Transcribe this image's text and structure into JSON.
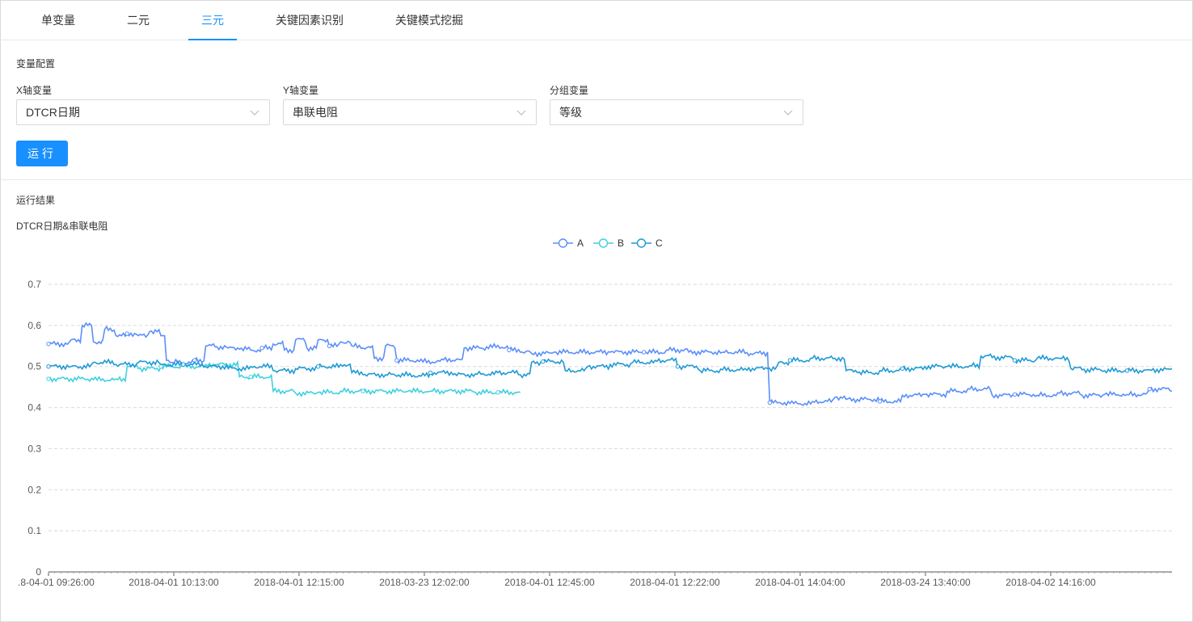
{
  "tabs": [
    {
      "label": "单变量",
      "active": false
    },
    {
      "label": "二元",
      "active": false
    },
    {
      "label": "三元",
      "active": true
    },
    {
      "label": "关键因素识别",
      "active": false
    },
    {
      "label": "关键模式挖掘",
      "active": false
    }
  ],
  "config": {
    "title": "变量配置",
    "x_label": "X轴变量",
    "x_value": "DTCR日期",
    "y_label": "Y轴变量",
    "y_value": "串联电阻",
    "group_label": "分组变量",
    "group_value": "等级",
    "run_label": "运行"
  },
  "result": {
    "title": "运行结果",
    "chart_title": "DTCR日期&串联电阻"
  },
  "colors": {
    "accent": "#1890ff",
    "series_a": "#5b8ff9",
    "series_b": "#3fd0e0",
    "series_c": "#1e9ad6"
  },
  "chart_data": {
    "type": "line",
    "title": "DTCR日期&串联电阻",
    "xlabel": "",
    "ylabel": "",
    "ylim": [
      0,
      0.7
    ],
    "y_ticks": [
      "0",
      "0.1",
      "0.2",
      "0.3",
      "0.4",
      "0.5",
      "0.6",
      "0.7"
    ],
    "x_tick_labels": [
      ".8-04-01 09:26:00",
      "2018-04-01 10:13:00",
      "2018-04-01 12:15:00",
      "2018-03-23 12:02:00",
      "2018-04-01 12:45:00",
      "2018-04-01 12:22:00",
      "2018-04-01 14:04:00",
      "2018-03-24 13:40:00",
      "2018-04-02 14:16:00"
    ],
    "legend": [
      "A",
      "B",
      "C"
    ],
    "legend_position": "top-center",
    "grid": true,
    "x_range": [
      0,
      100
    ],
    "series": [
      {
        "name": "A",
        "x": [
          0,
          2,
          3,
          4,
          5,
          6,
          7,
          8,
          9,
          10,
          10.5,
          11,
          13,
          14,
          15,
          16,
          17,
          18,
          19,
          20,
          21,
          22,
          23,
          24,
          25,
          26,
          27,
          28,
          29,
          30,
          31,
          33,
          35,
          36,
          37,
          39,
          41,
          42,
          43,
          45,
          47,
          50,
          53,
          55,
          57,
          60,
          62,
          64,
          64.2,
          66,
          68,
          70,
          71,
          72,
          74,
          76,
          78,
          80,
          82,
          84,
          86,
          88,
          90,
          92,
          94,
          96,
          98,
          100
        ],
        "values": [
          0.555,
          0.565,
          0.6,
          0.56,
          0.59,
          0.575,
          0.58,
          0.575,
          0.585,
          0.575,
          0.515,
          0.51,
          0.515,
          0.55,
          0.548,
          0.545,
          0.542,
          0.54,
          0.545,
          0.555,
          0.54,
          0.565,
          0.545,
          0.565,
          0.55,
          0.56,
          0.55,
          0.545,
          0.52,
          0.55,
          0.515,
          0.512,
          0.518,
          0.515,
          0.545,
          0.548,
          0.54,
          0.535,
          0.532,
          0.535,
          0.535,
          0.535,
          0.535,
          0.54,
          0.535,
          0.535,
          0.532,
          0.535,
          0.412,
          0.41,
          0.415,
          0.425,
          0.42,
          0.42,
          0.415,
          0.43,
          0.432,
          0.44,
          0.445,
          0.43,
          0.432,
          0.43,
          0.435,
          0.43,
          0.432,
          0.432,
          0.445,
          0.44
        ]
      },
      {
        "name": "B",
        "x": [
          0,
          2,
          4,
          6,
          7,
          8,
          10,
          11,
          12,
          14,
          15,
          17,
          18,
          19,
          20,
          22,
          24,
          26,
          28,
          30,
          32,
          34,
          36,
          38,
          40,
          42
        ],
        "values": [
          0.47,
          0.47,
          0.468,
          0.47,
          0.5,
          0.495,
          0.5,
          0.5,
          0.5,
          0.505,
          0.505,
          0.475,
          0.475,
          0.475,
          0.44,
          0.435,
          0.437,
          0.44,
          0.44,
          0.44,
          0.44,
          0.44,
          0.44,
          0.437,
          0.437,
          0.437
        ]
      },
      {
        "name": "C",
        "x": [
          0,
          2,
          4,
          6,
          8,
          10,
          12,
          14,
          16,
          18,
          20,
          22,
          24,
          26,
          27,
          28,
          30,
          32,
          34,
          36,
          38,
          40,
          42,
          43,
          44,
          46,
          48,
          50,
          52,
          54,
          56,
          58,
          60,
          62,
          64,
          65,
          66,
          68,
          70,
          71,
          72,
          74,
          76,
          78,
          80,
          82,
          83,
          84,
          86,
          88,
          90,
          91,
          92,
          94,
          96,
          98,
          100
        ],
        "values": [
          0.5,
          0.5,
          0.51,
          0.505,
          0.51,
          0.505,
          0.505,
          0.5,
          0.495,
          0.5,
          0.49,
          0.495,
          0.5,
          0.505,
          0.485,
          0.48,
          0.48,
          0.478,
          0.485,
          0.48,
          0.482,
          0.485,
          0.48,
          0.51,
          0.512,
          0.49,
          0.5,
          0.505,
          0.51,
          0.515,
          0.5,
          0.49,
          0.492,
          0.495,
          0.495,
          0.51,
          0.515,
          0.52,
          0.52,
          0.49,
          0.485,
          0.49,
          0.495,
          0.5,
          0.5,
          0.502,
          0.525,
          0.522,
          0.515,
          0.52,
          0.52,
          0.495,
          0.492,
          0.49,
          0.49,
          0.492,
          0.495
        ]
      }
    ]
  }
}
